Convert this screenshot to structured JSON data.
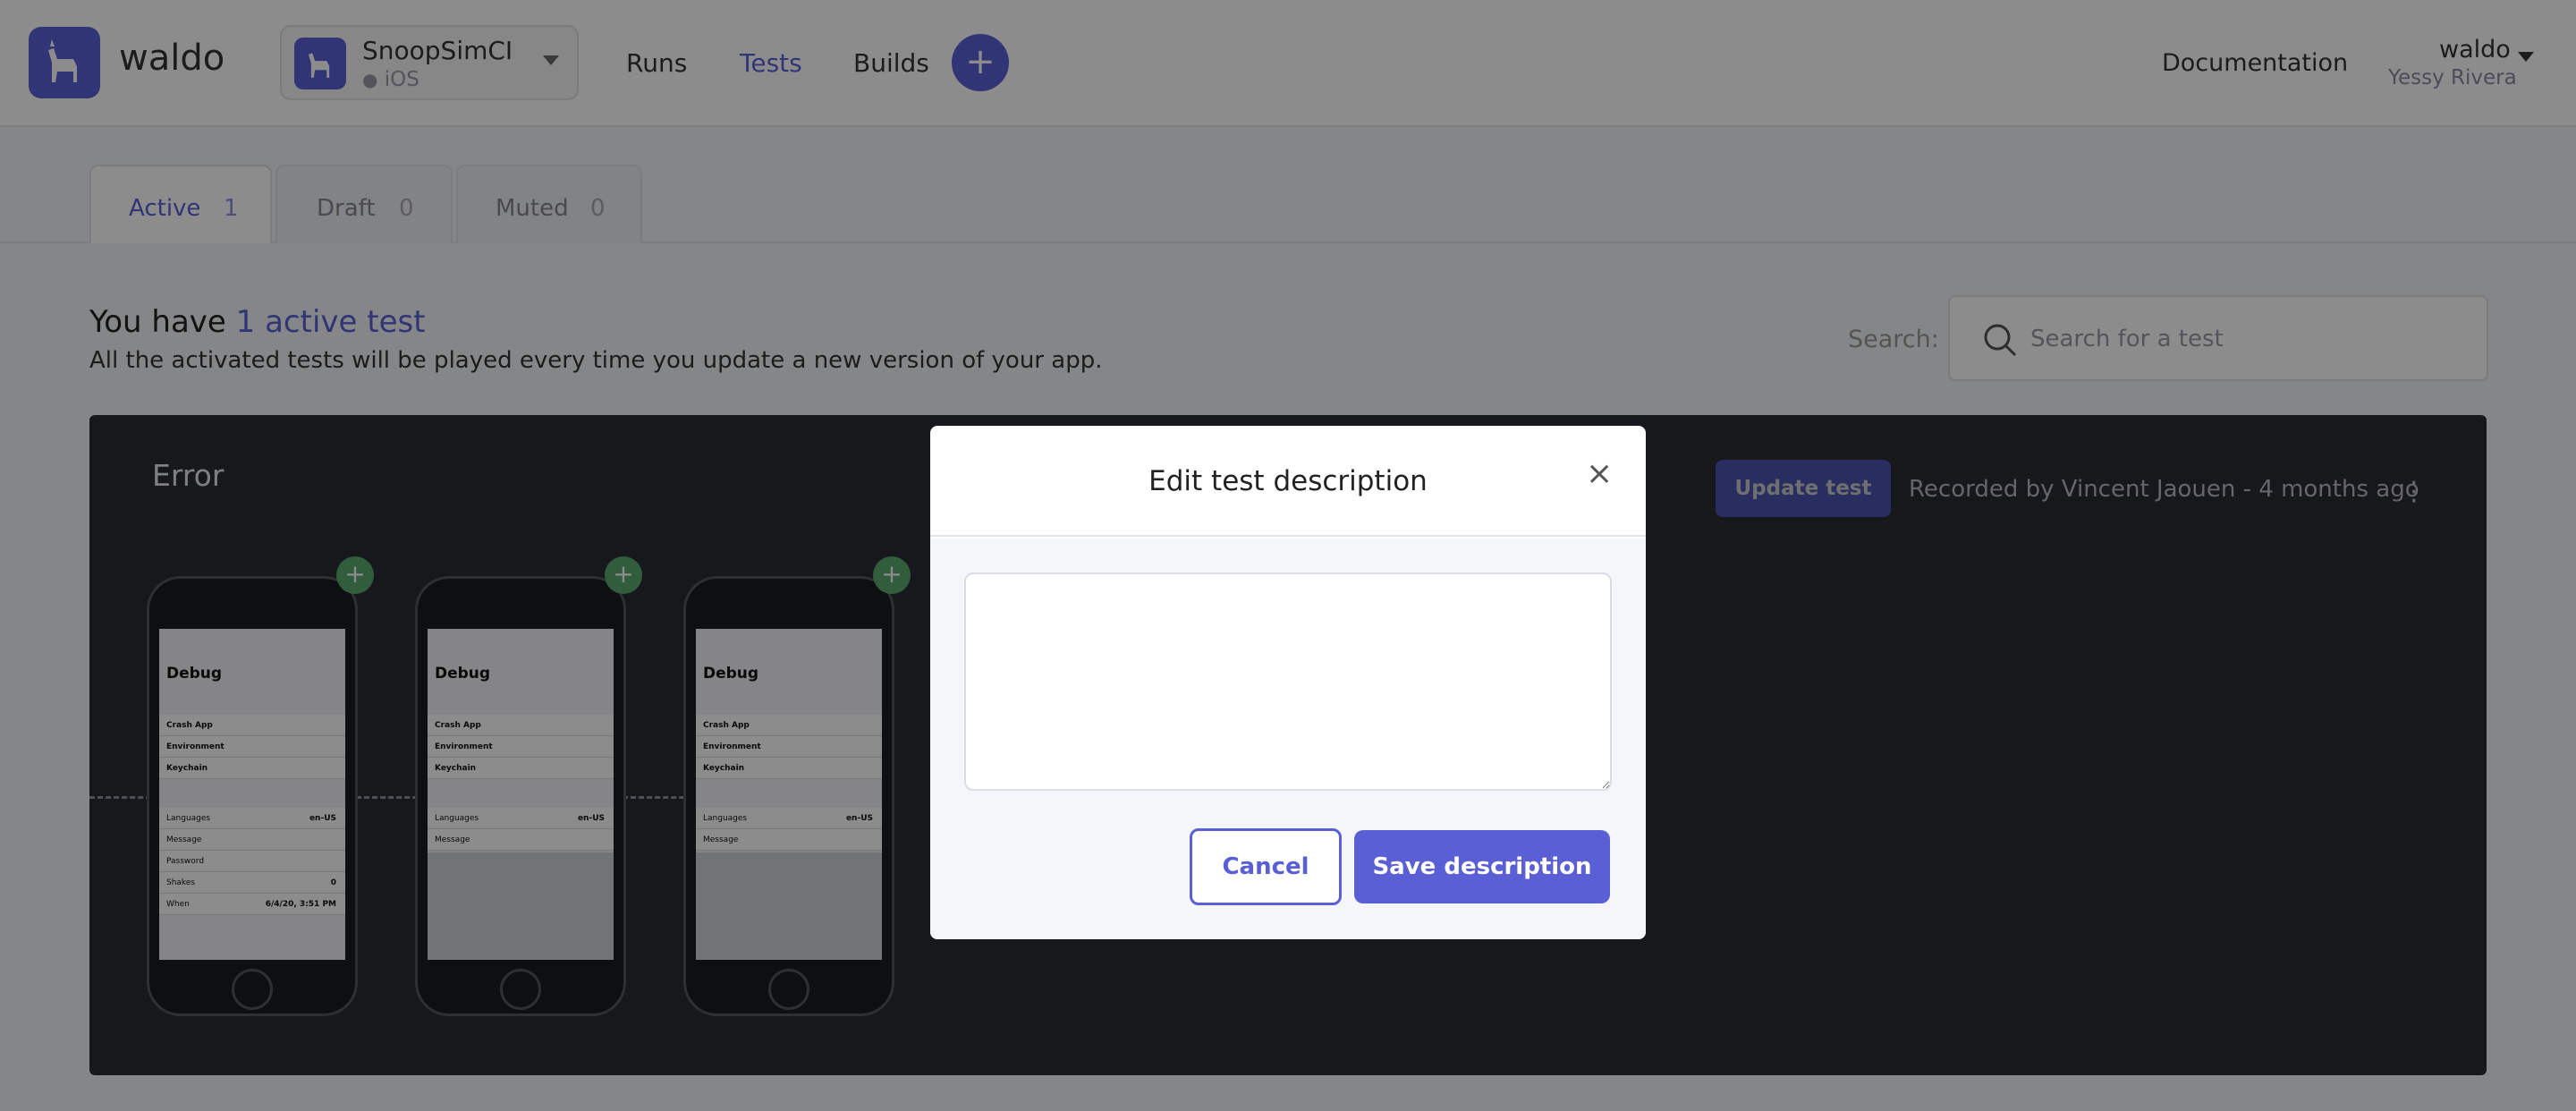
{
  "header": {
    "brand": "waldo",
    "app": {
      "name": "SnoopSimCI",
      "platform": "iOS"
    },
    "nav": [
      "Runs",
      "Tests",
      "Builds"
    ],
    "active_nav": "Tests",
    "plus_label": "+",
    "documentation": "Documentation",
    "user": {
      "name": "waldo",
      "org": "Yessy Rivera"
    }
  },
  "tabs": [
    {
      "label": "Active",
      "count": "1"
    },
    {
      "label": "Draft",
      "count": "0"
    },
    {
      "label": "Muted",
      "count": "0"
    }
  ],
  "summary": {
    "prefix": "You have ",
    "highlight": "1 active test",
    "subtitle": "All the activated tests will be played every time you update a new version of your app."
  },
  "search": {
    "label": "Search:",
    "placeholder": "Search for a test"
  },
  "test": {
    "title": "Error",
    "update_label": "Update test",
    "recorded": "Recorded by Vincent Jaouen - 4 months ago",
    "step_add": "+",
    "screens": {
      "title": "Debug",
      "rows": [
        "Crash App",
        "Environment",
        "Keychain"
      ],
      "languages_label": "Languages",
      "languages_value": "en-US",
      "message_label": "Message",
      "password_label": "Password",
      "shakes_label": "Shakes",
      "shakes_value": "0",
      "when_label": "When",
      "when_value": "6/4/20, 3:51 PM"
    }
  },
  "modal": {
    "title": "Edit test description",
    "close": "×",
    "textarea_value": "",
    "cancel": "Cancel",
    "save": "Save description"
  },
  "colors": {
    "accent": "#5a5fd6",
    "panel": "#2a2c33",
    "step_badge": "#5aa96e"
  }
}
